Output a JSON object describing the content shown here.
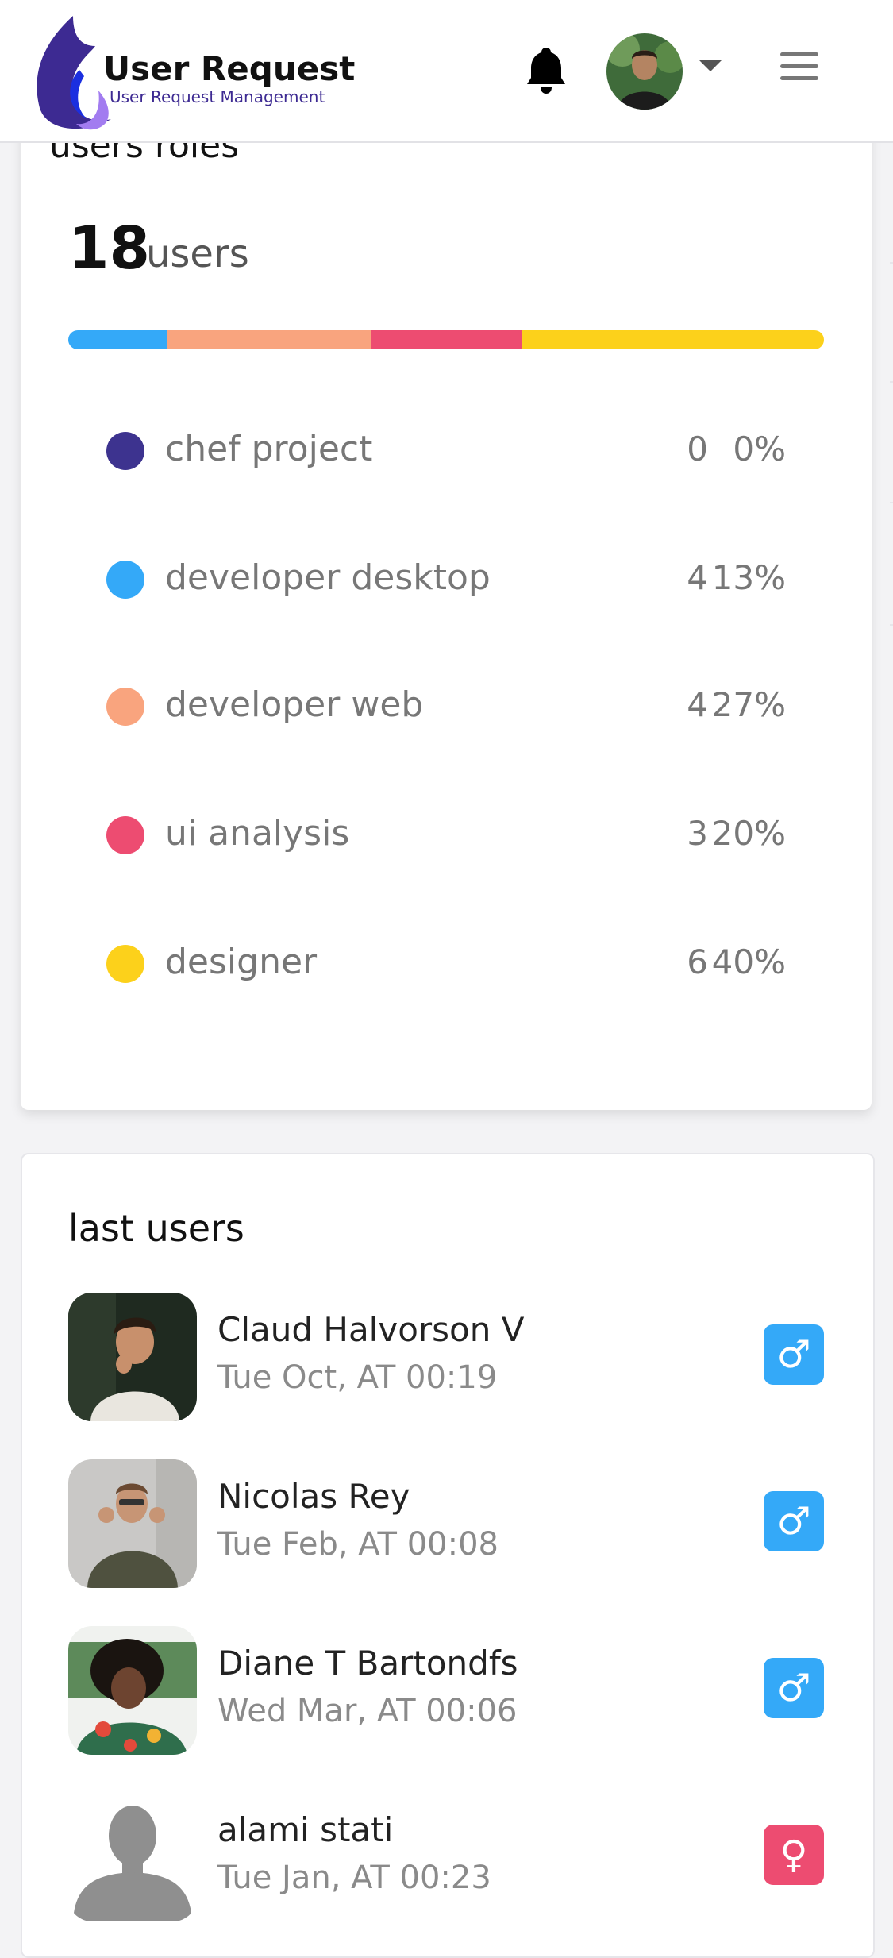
{
  "header": {
    "logo_title": "User Request",
    "logo_subtitle": "User Request Management",
    "icons": {
      "notifications": "bell-icon",
      "avatar": "avatar",
      "dropdown": "caret-down-icon",
      "menu": "hamburger-menu-icon"
    }
  },
  "roles_card": {
    "title": "users roles",
    "total_count": "18",
    "total_unit": "users",
    "progress_segments": [
      {
        "role": "developer desktop",
        "fraction": 0.13,
        "color": "#34a9f8"
      },
      {
        "role": "developer web",
        "fraction": 0.27,
        "color": "#f9a47e"
      },
      {
        "role": "ui analysis",
        "fraction": 0.2,
        "color": "#ed4c71"
      },
      {
        "role": "designer",
        "fraction": 0.4,
        "color": "#fcd11b"
      }
    ],
    "roles": [
      {
        "name": "chef project",
        "count": "0",
        "percent": "0%",
        "color": "#3d338f"
      },
      {
        "name": "developer desktop",
        "count": "4",
        "percent": "13%",
        "color": "#34a9f8"
      },
      {
        "name": "developer web",
        "count": "4",
        "percent": "27%",
        "color": "#f9a47e"
      },
      {
        "name": "ui analysis",
        "count": "3",
        "percent": "20%",
        "color": "#ed4c71"
      },
      {
        "name": "designer",
        "count": "6",
        "percent": "40%",
        "color": "#fcd11b"
      }
    ]
  },
  "last_users": {
    "title": "last users",
    "users": [
      {
        "name": "Claud Halvorson V",
        "date": "Tue Oct, AT 00:19",
        "gender": "male",
        "gender_symbol": "♂",
        "badge_color": "#34a9f8"
      },
      {
        "name": "Nicolas Rey",
        "date": "Tue Feb, AT 00:08",
        "gender": "male",
        "gender_symbol": "♂",
        "badge_color": "#34a9f8"
      },
      {
        "name": "Diane T Bartondfs",
        "date": "Wed Mar, AT 00:06",
        "gender": "male",
        "gender_symbol": "♂",
        "badge_color": "#34a9f8"
      },
      {
        "name": "alami stati",
        "date": "Tue Jan, AT 00:23",
        "gender": "female",
        "gender_symbol": "♀",
        "badge_color": "#ed4c71"
      }
    ]
  }
}
